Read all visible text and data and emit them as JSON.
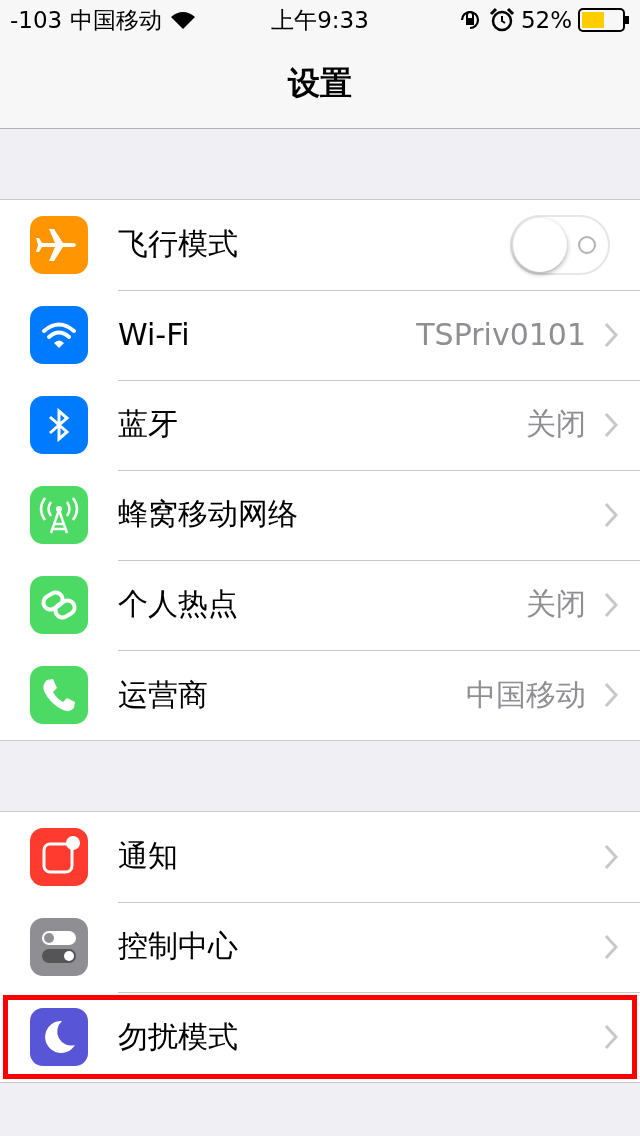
{
  "status_bar": {
    "signal": "-103",
    "carrier": "中国移动",
    "time": "上午9:33",
    "battery": "52%"
  },
  "nav": {
    "title": "设置"
  },
  "groups": [
    {
      "rows": [
        {
          "kind": "toggle",
          "color": "#ff9500",
          "label": "飞行模式",
          "on": false
        },
        {
          "kind": "link",
          "color": "#007aff",
          "label": "Wi-Fi",
          "value": "TSPriv0101"
        },
        {
          "kind": "link",
          "color": "#007aff",
          "label": "蓝牙",
          "value": "关闭"
        },
        {
          "kind": "link",
          "color": "#4cd964",
          "label": "蜂窝移动网络"
        },
        {
          "kind": "link",
          "color": "#4cd964",
          "label": "个人热点",
          "value": "关闭"
        },
        {
          "kind": "link",
          "color": "#4cd964",
          "label": "运营商",
          "value": "中国移动"
        }
      ]
    },
    {
      "rows": [
        {
          "kind": "link",
          "color": "#ff3b30",
          "label": "通知",
          "highlighted": false
        },
        {
          "kind": "link",
          "color": "#8e8e93",
          "label": "控制中心",
          "highlighted": false
        },
        {
          "kind": "link",
          "color": "#5856d6",
          "label": "勿扰模式",
          "highlighted": true
        }
      ]
    }
  ]
}
